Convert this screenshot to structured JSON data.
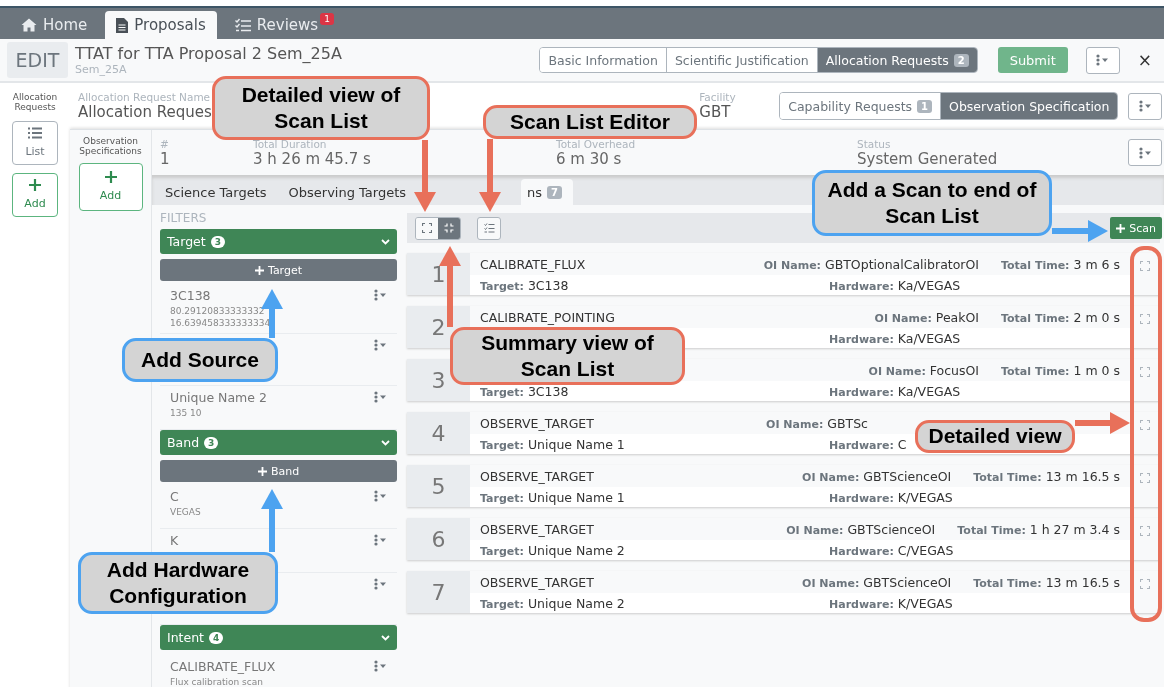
{
  "nav_tabs": [
    {
      "kind": "home",
      "label": "Home",
      "selected": false
    },
    {
      "kind": "document",
      "label": "Proposals",
      "selected": true
    },
    {
      "kind": "checklist",
      "label": "Reviews",
      "badge": "1",
      "selected": false
    }
  ],
  "header": {
    "mode": "EDIT",
    "title": "TTAT for TTA Proposal 2 Sem_25A",
    "subtitle": "Sem_25A",
    "sections": [
      {
        "label": "Basic Information",
        "selected": false
      },
      {
        "label": "Scientific Justification",
        "selected": false
      },
      {
        "label": "Allocation Requests",
        "badge": "2",
        "selected": true
      }
    ],
    "submit": "Submit",
    "close": "×"
  },
  "sidebar": {
    "title": "Allocation Requests",
    "buttons": [
      {
        "kind": "list",
        "label": "List"
      },
      {
        "kind": "add",
        "label": "Add"
      }
    ]
  },
  "request": {
    "name_label": "Allocation Request Name",
    "name": "Allocation Reques",
    "facility_label": "Facility",
    "facility": "GBT",
    "sections": [
      {
        "label": "Capability Requests",
        "badge": "1",
        "selected": false
      },
      {
        "label": "Observation Specification",
        "selected": true
      }
    ]
  },
  "spec_sidebar": {
    "title": "Observation Specifications",
    "add_button": "Add"
  },
  "summary": [
    {
      "label": "#",
      "value": "1"
    },
    {
      "label": "Total Duration",
      "value": "3 h 26 m 45.7 s"
    },
    {
      "label": "Total Overhead",
      "value": "6 m 30 s"
    },
    {
      "label": "Status",
      "value": "System Generated"
    }
  ],
  "content_tabs": [
    {
      "label": "Science Targets",
      "selected": false
    },
    {
      "label": "Observing Targets",
      "selected": false
    },
    {
      "label": "ns",
      "badge": "7",
      "selected": true
    }
  ],
  "filters": {
    "title": "FILTERS",
    "groups": [
      {
        "title": "Target",
        "count": "3",
        "add_label": "Target",
        "items": [
          {
            "kind": "entry",
            "name": "3C138",
            "details": [
              "80.29120833333332",
              "16.639458333333334"
            ]
          },
          {
            "kind": "entry"
          },
          {
            "kind": "entry",
            "name": "Unique Name 2",
            "details": [
              "135 10"
            ]
          }
        ]
      },
      {
        "title": "Band",
        "count": "3",
        "add_label": "Band",
        "items": [
          {
            "kind": "entry",
            "name": "C",
            "details": [
              "VEGAS"
            ]
          },
          {
            "kind": "entry",
            "name": "K"
          },
          {
            "kind": "entry"
          }
        ]
      },
      {
        "title": "Intent",
        "count": "4",
        "items": [
          {
            "kind": "entry",
            "name": "CALIBRATE_FLUX",
            "details": [
              "Flux calibration scan"
            ]
          }
        ]
      }
    ]
  },
  "scans": {
    "view_modes": [
      {
        "kind": "detailed",
        "selected": false
      },
      {
        "kind": "summary",
        "selected": true
      }
    ],
    "add_button": "Scan",
    "rows": [
      {
        "number": "1",
        "intent": "CALIBRATE_FLUX",
        "top_fields": [
          {
            "kind": "oi",
            "label": "OI Name:",
            "value": "GBTOptionalCalibratorOI"
          },
          {
            "kind": "time",
            "label": "Total Time:",
            "value": "3 m 6 s"
          }
        ],
        "bottom_fields": [
          {
            "kind": "target",
            "label": "Target:",
            "value": "3C138"
          },
          {
            "kind": "hardware",
            "label": "Hardware:",
            "value": "Ka/VEGAS"
          }
        ]
      },
      {
        "number": "2",
        "intent": "CALIBRATE_POINTING",
        "top_fields": [
          {
            "kind": "oi",
            "label": "OI Name:",
            "value": "PeakOI"
          },
          {
            "kind": "time",
            "label": "Total Time:",
            "value": "2 m 0 s"
          }
        ],
        "bottom_fields": [
          {
            "kind": "hardware",
            "label": "Hardware:",
            "value": "Ka/VEGAS"
          }
        ]
      },
      {
        "number": "3",
        "top_fields": [
          {
            "kind": "oi",
            "label": "OI Name:",
            "value": "FocusOI"
          },
          {
            "kind": "time",
            "label": "Total Time:",
            "value": "1 m 0 s"
          }
        ],
        "bottom_fields": [
          {
            "kind": "target",
            "label": "Target:",
            "value": "3C138"
          },
          {
            "kind": "hardware",
            "label": "Hardware:",
            "value": "Ka/VEGAS"
          }
        ]
      },
      {
        "number": "4",
        "intent": "OBSERVE_TARGET",
        "top_fields": [
          {
            "kind": "oi",
            "label": "OI Name:",
            "value": "GBTSc"
          }
        ],
        "bottom_fields": [
          {
            "kind": "target",
            "label": "Target:",
            "value": "Unique Name 1"
          },
          {
            "kind": "hardware",
            "label": "Hardware:",
            "value": "C"
          }
        ]
      },
      {
        "number": "5",
        "intent": "OBSERVE_TARGET",
        "top_fields": [
          {
            "kind": "oi",
            "label": "OI Name:",
            "value": "GBTScienceOI"
          },
          {
            "kind": "time",
            "label": "Total Time:",
            "value": "13 m 16.5 s"
          }
        ],
        "bottom_fields": [
          {
            "kind": "target",
            "label": "Target:",
            "value": "Unique Name 1"
          },
          {
            "kind": "hardware",
            "label": "Hardware:",
            "value": "K/VEGAS"
          }
        ]
      },
      {
        "number": "6",
        "intent": "OBSERVE_TARGET",
        "top_fields": [
          {
            "kind": "oi",
            "label": "OI Name:",
            "value": "GBTScienceOI"
          },
          {
            "kind": "time",
            "label": "Total Time:",
            "value": "1 h 27 m 3.4 s"
          }
        ],
        "bottom_fields": [
          {
            "kind": "target",
            "label": "Target:",
            "value": "Unique Name 2"
          },
          {
            "kind": "hardware",
            "label": "Hardware:",
            "value": "C/VEGAS"
          }
        ]
      },
      {
        "number": "7",
        "intent": "OBSERVE_TARGET",
        "top_fields": [
          {
            "kind": "oi",
            "label": "OI Name:",
            "value": "GBTScienceOI"
          },
          {
            "kind": "time",
            "label": "Total Time:",
            "value": "13 m 16.5 s"
          }
        ],
        "bottom_fields": [
          {
            "kind": "target",
            "label": "Target:",
            "value": "Unique Name 2"
          },
          {
            "kind": "hardware",
            "label": "Hardware:",
            "value": "K/VEGAS"
          }
        ]
      }
    ]
  },
  "annotations": [
    {
      "text": "Detailed view of Scan List",
      "color": "#e8705a"
    },
    {
      "text": "Scan List Editor",
      "color": "#e8705a"
    },
    {
      "text": "Add a Scan to end of Scan List",
      "color": "#4da3f0"
    },
    {
      "text": "Add Source",
      "color": "#4da3f0"
    },
    {
      "text": "Summary view of Scan List",
      "color": "#e8705a"
    },
    {
      "text": "Add Hardware Configuration",
      "color": "#4da3f0"
    },
    {
      "text": "Detailed view",
      "color": "#e8705a"
    }
  ],
  "highlight": {
    "color": "#e8705a"
  }
}
